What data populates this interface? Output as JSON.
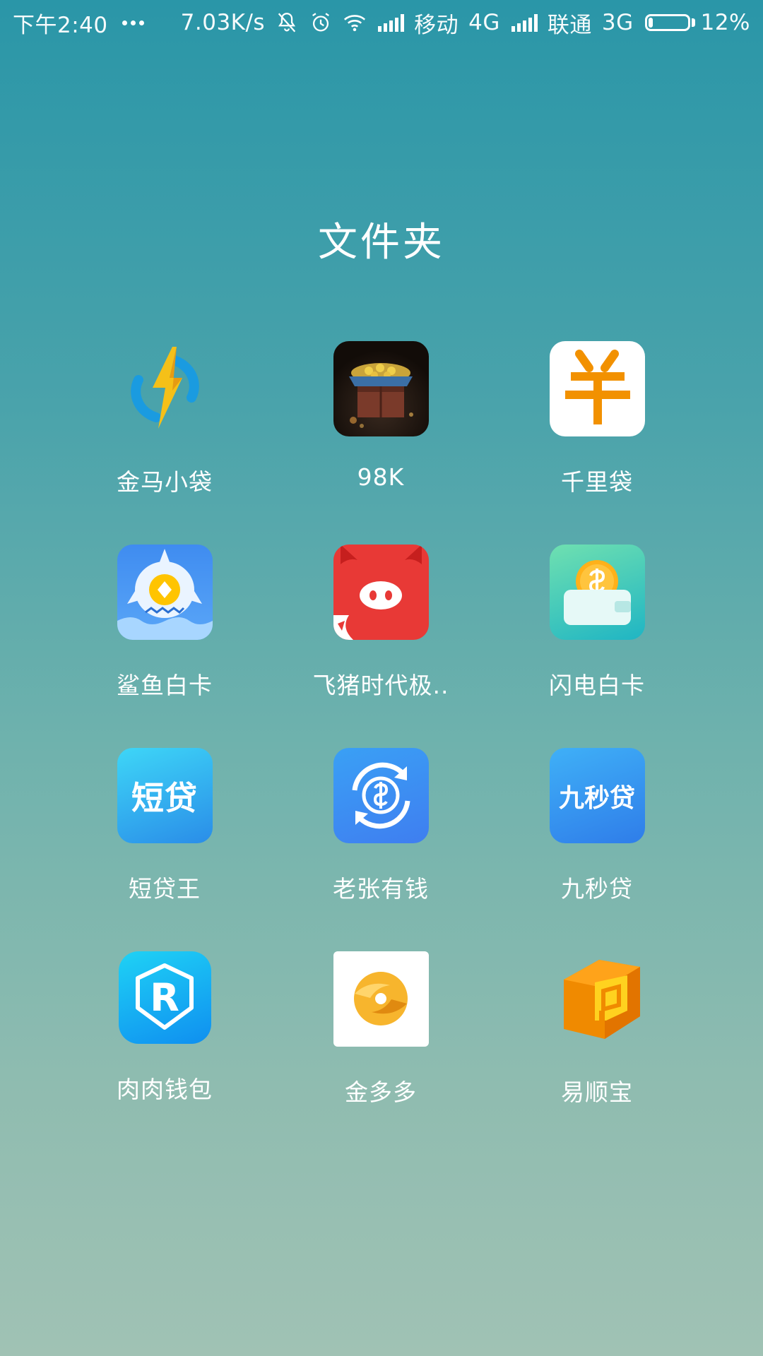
{
  "status_bar": {
    "time": "下午2:40",
    "net_speed": "7.03K/s",
    "carrier1": "移动",
    "net1": "4G",
    "carrier2": "联通",
    "net2": "3G",
    "battery_text": "12%",
    "battery_level": 0.12
  },
  "folder": {
    "title": "文件夹"
  },
  "apps": [
    {
      "label": "金马小袋",
      "icon": "lightning-icon"
    },
    {
      "label": "98K",
      "icon": "treasure-crate-icon"
    },
    {
      "label": "千里袋",
      "icon": "yen-icon"
    },
    {
      "label": "鲨鱼白卡",
      "icon": "shark-icon"
    },
    {
      "label": "飞猪时代极..",
      "icon": "pig-icon"
    },
    {
      "label": "闪电白卡",
      "icon": "wallet-coin-icon"
    },
    {
      "label": "短贷王",
      "icon": "text-logo-icon",
      "logo_text": "短贷"
    },
    {
      "label": "老张有钱",
      "icon": "dollar-cycle-icon"
    },
    {
      "label": "九秒贷",
      "icon": "text-logo-icon",
      "logo_text": "九秒贷"
    },
    {
      "label": "肉肉钱包",
      "icon": "shield-r-icon",
      "logo_text": "R"
    },
    {
      "label": "金多多",
      "icon": "orange-swirl-icon"
    },
    {
      "label": "易顺宝",
      "icon": "orange-block-icon"
    }
  ]
}
